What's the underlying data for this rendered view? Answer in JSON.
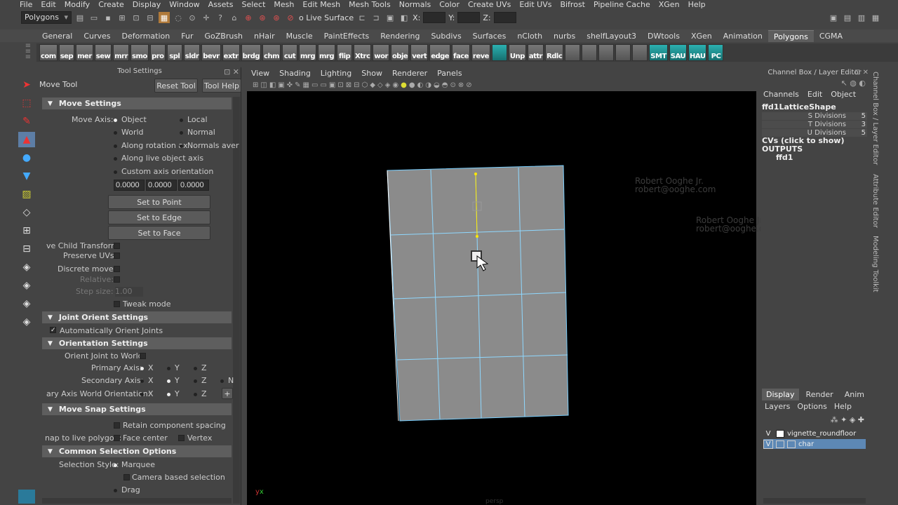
{
  "menubar": [
    "File",
    "Edit",
    "Modify",
    "Create",
    "Display",
    "Window",
    "Assets",
    "Select",
    "Mesh",
    "Edit Mesh",
    "Mesh Tools",
    "Normals",
    "Color",
    "Create UVs",
    "Edit UVs",
    "Bifrost",
    "Pipeline Cache",
    "XGen",
    "Help"
  ],
  "status": {
    "mode": "Polygons",
    "live_surface": "o Live Surface",
    "x_label": "X:",
    "y_label": "Y:",
    "z_label": "Z:"
  },
  "shelf_tabs": [
    "General",
    "Curves",
    "Deformation",
    "Fur",
    "GoZBrush",
    "nHair",
    "Muscle",
    "PaintEffects",
    "Rendering",
    "Subdivs",
    "Surfaces",
    "nCloth",
    "nurbs",
    "shelfLayout3",
    "DWtools",
    "XGen",
    "Animation",
    "Polygons",
    "CGMA"
  ],
  "shelf_active": "Polygons",
  "shelf_buttons": [
    "com",
    "sep",
    "mer",
    "sew",
    "mrr",
    "smo",
    "pro",
    "spl",
    "sldr",
    "bevr",
    "extr",
    "brdg",
    "chm",
    "cut",
    "mrg",
    "mrg",
    "flip",
    "Xtrc",
    "wor",
    "obje",
    "vert",
    "edge",
    "face",
    "reve"
  ],
  "shelf_buttons_right": [
    "Unp",
    "attr",
    "Rdlc",
    "SMT",
    "SAU",
    "HAU",
    "PC"
  ],
  "tool_settings": {
    "title": "Tool Settings",
    "tool_name": "Move Tool",
    "reset_label": "Reset Tool",
    "help_label": "Tool Help",
    "move_settings": "Move Settings",
    "move_axis_label": "Move Axis:",
    "axis_object": "Object",
    "axis_local": "Local",
    "axis_world": "World",
    "axis_normal": "Normal",
    "axis_along_rotation": "Along rotation ax",
    "axis_normals_average": "Normals aver",
    "axis_live_object": "Along live object axis",
    "axis_custom": "Custom axis orientation",
    "custom_values": [
      "0.0000",
      "0.0000",
      "0.0000"
    ],
    "set_to_point": "Set to Point",
    "set_to_edge": "Set to Edge",
    "set_to_face": "Set to Face",
    "preserve_child": "ve Child Transform",
    "preserve_uvs": "Preserve UVs",
    "discrete_move": "Discrete move:",
    "relative": "Relative:",
    "step_size": "Step size:",
    "step_value": "1.00",
    "tweak_mode": "Tweak mode",
    "joint_orient_settings": "Joint Orient Settings",
    "auto_orient": "Automatically Orient Joints",
    "orientation_settings": "Orientation Settings",
    "orient_joint_world": "Orient Joint to World:",
    "primary_axis": "Primary Axis:",
    "secondary_axis": "Secondary Axis:",
    "secondary_world": "ary Axis World Orientation:",
    "x": "X",
    "y": "Y",
    "z": "Z",
    "n": "N",
    "plus": "+",
    "move_snap_settings": "Move Snap Settings",
    "retain_spacing": "Retain component spacing",
    "snap_live_poly": "nap to live polygon:",
    "face_center": "Face center",
    "vertex": "Vertex",
    "common_selection": "Common Selection Options",
    "selection_style": "Selection Style:",
    "marquee": "Marquee",
    "camera_based": "Camera based selection",
    "drag": "Drag"
  },
  "viewport_menu": [
    "View",
    "Shading",
    "Lighting",
    "Show",
    "Renderer",
    "Panels"
  ],
  "watermark": {
    "name": "Robert Ooghe Jr.",
    "email": "robert@ooghe.com"
  },
  "camera_label": "persp",
  "channel_box": {
    "title": "Channel Box / Layer Editor",
    "menu": [
      "Channels",
      "Edit",
      "Object"
    ],
    "object_name": "ffd1LatticeShape",
    "attrs": [
      {
        "name": "S Divisions",
        "value": "5"
      },
      {
        "name": "T Divisions",
        "value": "3"
      },
      {
        "name": "U Divisions",
        "value": "5"
      }
    ],
    "cvs": "CVs (click to show)",
    "outputs": "OUTPUTS",
    "output_node": "ffd1"
  },
  "side_tabs": [
    "Channel Box / Layer Editor",
    "Attribute Editor",
    "Modeling Toolkit"
  ],
  "layer_editor": {
    "tabs": [
      "Display",
      "Render",
      "Anim"
    ],
    "menu": [
      "Layers",
      "Options",
      "Help"
    ],
    "layers": [
      {
        "v": "V",
        "name": "vignette_roundfloor"
      },
      {
        "v": "V",
        "name": "char"
      }
    ]
  },
  "colors": {
    "selection": "#5d88b5",
    "active_tab": "#5d5d5d",
    "lattice_line": "#8fd8ff",
    "lattice_fill": "#8b8b8b"
  }
}
